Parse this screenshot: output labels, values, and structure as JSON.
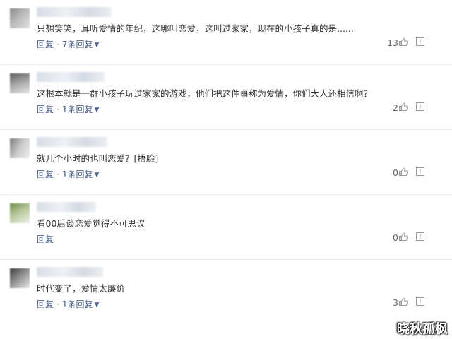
{
  "comments": [
    {
      "text": "只想笑笑，耳听爱情的年纪，这哪叫恋爱，这叫过家家，现在的小孩子真的是......",
      "reply_label": "回复",
      "thread_label": "7条回复",
      "likes": "13"
    },
    {
      "text": "这根本就是一群小孩子玩过家家的游戏，他们把这件事称为爱情，你们大人还相信啊？",
      "reply_label": "回复",
      "thread_label": "1条回复",
      "likes": "2"
    },
    {
      "text": "就几个小时的也叫恋爱？[捂脸]",
      "reply_label": "回复",
      "thread_label": "1条回复",
      "likes": "0"
    },
    {
      "text": "看00后谈恋爱觉得不可思议",
      "reply_label": "回复",
      "thread_label": "",
      "likes": "0"
    },
    {
      "text": "时代变了，爱情太廉价",
      "reply_label": "回复",
      "thread_label": "1条回复",
      "likes": "3"
    }
  ],
  "separator": "·",
  "watermark": "晓秋孤枫",
  "icons": {
    "like": "thumbs-up-icon",
    "report": "report-icon",
    "expand": "chevron-down-icon"
  },
  "colors": {
    "link": "#4a5f8c",
    "text": "#333333",
    "count": "#666666"
  }
}
